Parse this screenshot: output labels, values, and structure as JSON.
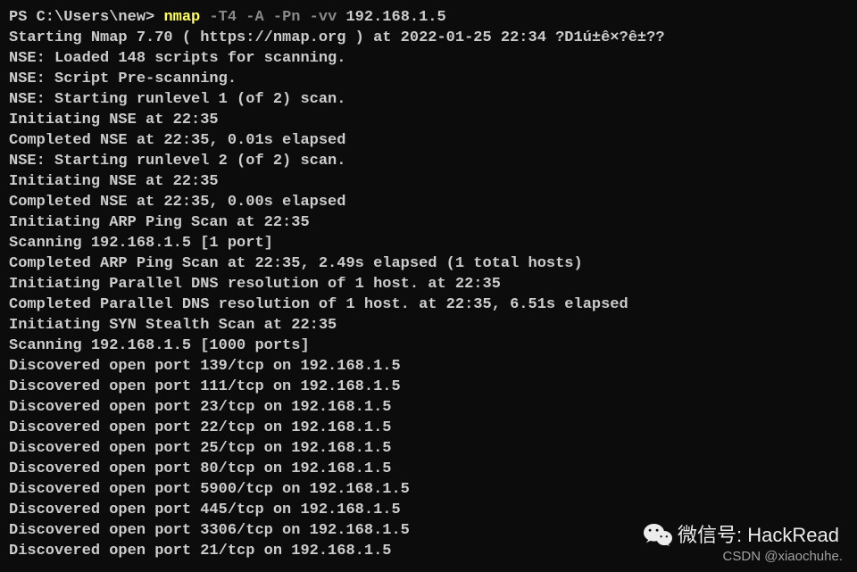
{
  "prompt": {
    "ps": "PS C:\\Users\\new> ",
    "command": "nmap",
    "flags": " -T4 -A -Pn -vv ",
    "target": "192.168.1.5"
  },
  "output_lines": [
    "Starting Nmap 7.70 ( https://nmap.org ) at 2022-01-25 22:34 ?D1ú±ê×?ê±??",
    "NSE: Loaded 148 scripts for scanning.",
    "NSE: Script Pre-scanning.",
    "NSE: Starting runlevel 1 (of 2) scan.",
    "Initiating NSE at 22:35",
    "Completed NSE at 22:35, 0.01s elapsed",
    "NSE: Starting runlevel 2 (of 2) scan.",
    "Initiating NSE at 22:35",
    "Completed NSE at 22:35, 0.00s elapsed",
    "Initiating ARP Ping Scan at 22:35",
    "Scanning 192.168.1.5 [1 port]",
    "Completed ARP Ping Scan at 22:35, 2.49s elapsed (1 total hosts)",
    "Initiating Parallel DNS resolution of 1 host. at 22:35",
    "Completed Parallel DNS resolution of 1 host. at 22:35, 6.51s elapsed",
    "Initiating SYN Stealth Scan at 22:35",
    "Scanning 192.168.1.5 [1000 ports]",
    "Discovered open port 139/tcp on 192.168.1.5",
    "Discovered open port 111/tcp on 192.168.1.5",
    "Discovered open port 23/tcp on 192.168.1.5",
    "Discovered open port 22/tcp on 192.168.1.5",
    "Discovered open port 25/tcp on 192.168.1.5",
    "Discovered open port 80/tcp on 192.168.1.5",
    "Discovered open port 5900/tcp on 192.168.1.5",
    "Discovered open port 445/tcp on 192.168.1.5",
    "Discovered open port 3306/tcp on 192.168.1.5",
    "Discovered open port 21/tcp on 192.168.1.5"
  ],
  "watermark": {
    "wechat_label": "微信号: HackRead",
    "csdn_label": "CSDN @xiaochuhe."
  }
}
